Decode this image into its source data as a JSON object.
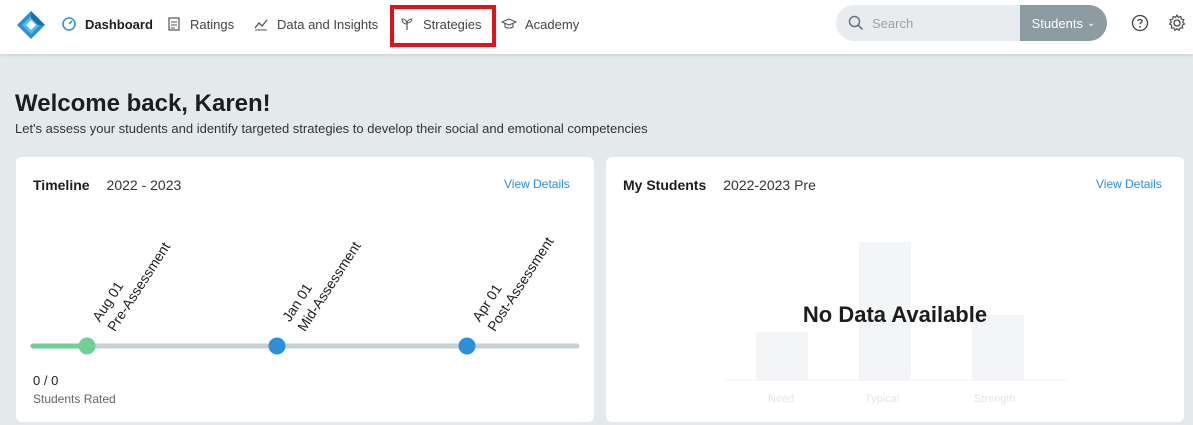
{
  "nav": {
    "items": [
      {
        "label": "Dashboard",
        "icon": "dashboard-icon",
        "active": true
      },
      {
        "label": "Ratings",
        "icon": "ratings-icon"
      },
      {
        "label": "Data and Insights",
        "icon": "chart-icon"
      },
      {
        "label": "Strategies",
        "icon": "sprout-icon"
      },
      {
        "label": "Academy",
        "icon": "graduation-cap-icon"
      }
    ],
    "search_placeholder": "Search",
    "students_button": "Students",
    "highlight_color": "#e0131b"
  },
  "welcome": {
    "title": "Welcome back, Karen!",
    "subtitle": "Let's assess your students and identify targeted strategies to develop their social and emotional competencies"
  },
  "timeline_card": {
    "title": "Timeline",
    "year": "2022 - 2023",
    "view_details": "View Details",
    "milestones": [
      {
        "date": "Aug 01",
        "name": "Pre-Assessment",
        "color": "#6fcf97"
      },
      {
        "date": "Jan 01",
        "name": "Mid-Assessment",
        "color": "#2b90d9"
      },
      {
        "date": "Apr 01",
        "name": "Post-Assessment",
        "color": "#2b90d9"
      }
    ],
    "progress": 0.1,
    "rated_count": "0 / 0",
    "rated_label": "Students Rated"
  },
  "students_card": {
    "title": "My Students",
    "period": "2022-2023 Pre",
    "view_details": "View Details",
    "no_data": "No Data Available",
    "categories": [
      "Need",
      "Typical",
      "Strength"
    ]
  },
  "colors": {
    "accent": "#2b90d9",
    "green": "#6fcf97",
    "track": "#c5d0d8",
    "students_btn": "#8d9ba3"
  }
}
